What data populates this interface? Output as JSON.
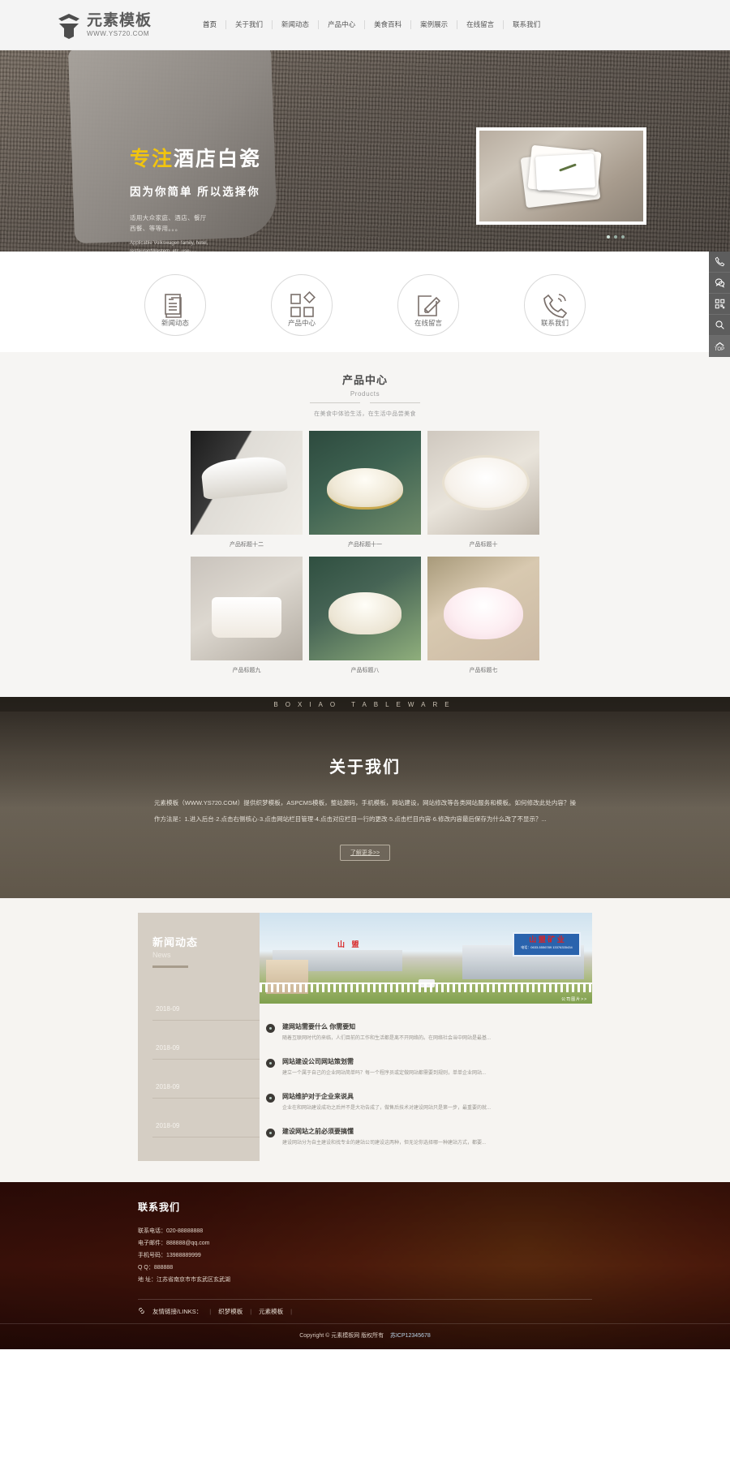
{
  "header": {
    "logo_cn": "元素模板",
    "logo_en": "WWW.YS720.COM",
    "nav": [
      {
        "label": "首页"
      },
      {
        "label": "关于我们"
      },
      {
        "label": "新闻动态"
      },
      {
        "label": "产品中心"
      },
      {
        "label": "美食百科"
      },
      {
        "label": "案例展示"
      },
      {
        "label": "在线留言"
      },
      {
        "label": "联系我们"
      }
    ]
  },
  "banner": {
    "highlight": "专注",
    "title_rest": "酒店白瓷",
    "subtitle": "因为你简单  所以选择你",
    "desc_line1": "适用大众家庭、酒店、餐厅",
    "desc_line2": "西餐、等等用。。。",
    "desc_en": "Applicable Volkswagen family, hotel, restaurantWestern, etc. use。。。"
  },
  "quick": [
    {
      "label": "新闻动态",
      "icon": "document-icon"
    },
    {
      "label": "产品中心",
      "icon": "grid-shapes-icon"
    },
    {
      "label": "在线留言",
      "icon": "pencil-note-icon"
    },
    {
      "label": "联系我们",
      "icon": "phone-icon"
    }
  ],
  "products": {
    "title_cn": "产品中心",
    "title_en": "Products",
    "desc": "在美食中体验生活，在生活中品尝美食",
    "items": [
      {
        "name": "产品标题十二"
      },
      {
        "name": "产品标题十一"
      },
      {
        "name": "产品标题十"
      },
      {
        "name": "产品标题九"
      },
      {
        "name": "产品标题八"
      },
      {
        "name": "产品标题七"
      }
    ]
  },
  "about": {
    "ribbon": "BOXIAO TABLEWARE",
    "title": "关于我们",
    "body": "元素模板（WWW.YS720.COM）提供织梦模板，ASPCMS模板，整站源码，手机模板，网站建设，网站修改等各类网站服务和模板。如何修改此处内容？操作方法是：1.进入后台·2.点击右侧核心·3.点击网站栏目管理·4.点击对应栏目一行的更改·5.点击栏目内容·6.修改内容最后保存为什么改了不显示？...",
    "more": "了解更多>>"
  },
  "news": {
    "title_cn": "新闻动态",
    "title_en": "News",
    "photo_caption": "公司图片>>",
    "sign_top": "山   盟",
    "sign_cn": "山 盟 矿 业",
    "sign_sub": "电话：0633-5556789  13376335434",
    "dates": [
      "2018-09",
      "2018-09",
      "2018-09",
      "2018-09"
    ],
    "items": [
      {
        "title": "建网站需要什么 你需要知",
        "desc": "随着互联网时代的来临，人们目前的工作和生活都是离不开网络的。在网络社会当中网站是最基..."
      },
      {
        "title": "网站建设公司网站策划需",
        "desc": "建立一个属于自己的企业网站简单吗？每一个程序员或定做网站都需要到规则，单单企业网站..."
      },
      {
        "title": "网站维护对于企业来说具",
        "desc": "企业在和网站建设成功之后并不是大功告成了，做售后技术对建设网站只是第一步，最重要的就..."
      },
      {
        "title": "建设网站之前必须要搞懂",
        "desc": "建设网站分为自主建设和找专业的建站公司建设这两种，但无论你选择哪一种建站方式，都要..."
      }
    ]
  },
  "footer": {
    "title": "联系我们",
    "lines": [
      "联系电话：020-88888888",
      "电子邮件：888888@qq.com",
      "手机号码：13988889999",
      "Q Q：888888",
      "地   址：江苏省南京市市玄武区玄武湖"
    ],
    "links_label": "友情链接/LINKS：",
    "links": [
      "织梦模板",
      "元素模板"
    ],
    "copyright": "Copyright © 元素模板网 版权所有",
    "icp": "苏ICP12345678"
  },
  "rtool": [
    {
      "icon": "phone-icon"
    },
    {
      "icon": "wechat-icon"
    },
    {
      "icon": "qrcode-icon"
    },
    {
      "icon": "search-icon"
    },
    {
      "icon": "top-icon",
      "label": "TOP"
    }
  ]
}
